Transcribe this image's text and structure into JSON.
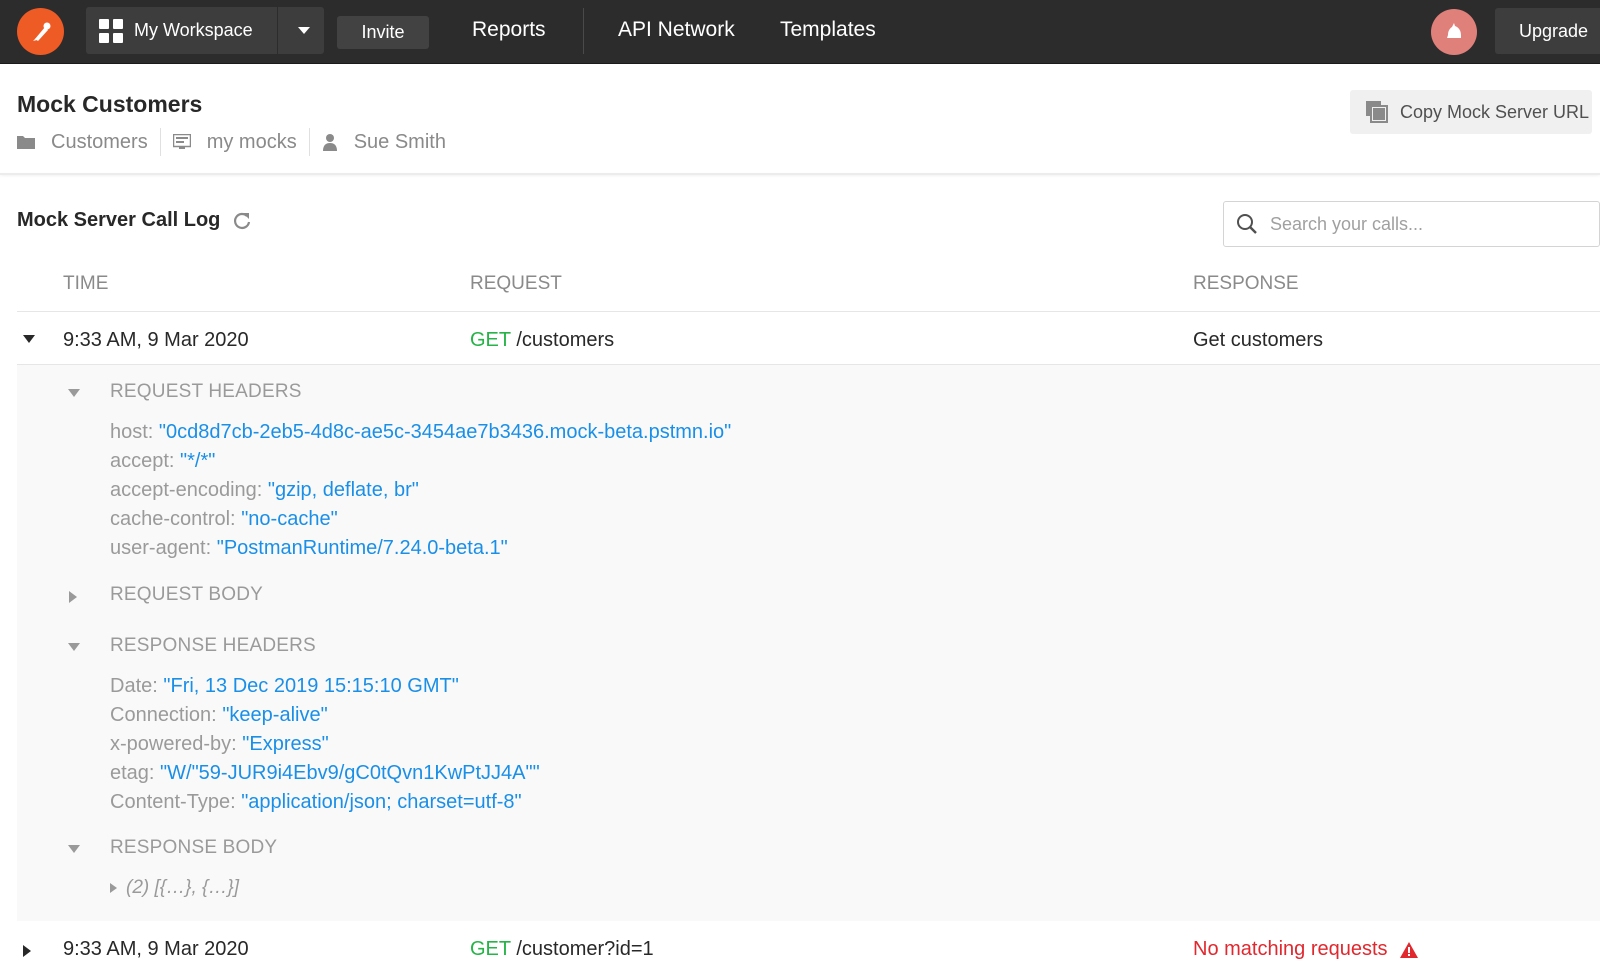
{
  "topbar": {
    "workspace_label": "My Workspace",
    "invite_label": "Invite",
    "nav": [
      "Reports",
      "API Network",
      "Templates"
    ],
    "upgrade_label": "Upgrade"
  },
  "header": {
    "title": "Mock Customers",
    "meta": {
      "collection": "Customers",
      "environment": "my mocks",
      "owner": "Sue Smith"
    },
    "copy_button": "Copy Mock Server URL"
  },
  "call_log": {
    "title": "Mock Server Call Log",
    "search_placeholder": "Search your calls...",
    "columns": {
      "time": "TIME",
      "request": "REQUEST",
      "response": "RESPONSE"
    },
    "rows": [
      {
        "time": "9:33 AM, 9 Mar 2020",
        "method": "GET",
        "path": "/customers",
        "response": "Get customers",
        "expanded": true
      },
      {
        "time": "9:33 AM, 9 Mar 2020",
        "method": "GET",
        "path": "/customer?id=1",
        "response": "No matching requests",
        "expanded": false
      }
    ],
    "details": {
      "request_headers_title": "REQUEST HEADERS",
      "request_headers": [
        {
          "key": "host:",
          "value": "\"0cd8d7cb-2eb5-4d8c-ae5c-3454ae7b3436.mock-beta.pstmn.io\""
        },
        {
          "key": "accept:",
          "value": "\"*/*\""
        },
        {
          "key": "accept-encoding:",
          "value": "\"gzip, deflate, br\""
        },
        {
          "key": "cache-control:",
          "value": "\"no-cache\""
        },
        {
          "key": "user-agent:",
          "value": "\"PostmanRuntime/7.24.0-beta.1\""
        }
      ],
      "request_body_title": "REQUEST BODY",
      "response_headers_title": "RESPONSE HEADERS",
      "response_headers": [
        {
          "key": "Date:",
          "value": "\"Fri, 13 Dec 2019 15:15:10 GMT\""
        },
        {
          "key": "Connection:",
          "value": "\"keep-alive\""
        },
        {
          "key": "x-powered-by:",
          "value": "\"Express\""
        },
        {
          "key": "etag:",
          "value": "\"W/\"59-JUR9i4Ebv9/gC0tQvn1KwPtJJ4A\"\""
        },
        {
          "key": "Content-Type:",
          "value": "\"application/json; charset=utf-8\""
        }
      ],
      "response_body_title": "RESPONSE BODY",
      "response_body_preview": "(2) [{…}, {…}]"
    }
  },
  "colors": {
    "topbar_bg": "#2c2c2c",
    "brand_orange": "#ef5b25",
    "method_green": "#26b347",
    "value_blue": "#1a8fe8",
    "error_red": "#e0282e"
  },
  "icons": [
    "postman-logo-icon",
    "grid-icon",
    "chevron-down-icon",
    "avatar-icon",
    "folder-icon",
    "environment-icon",
    "user-icon",
    "copy-icon",
    "refresh-icon",
    "search-icon",
    "warning-icon"
  ]
}
